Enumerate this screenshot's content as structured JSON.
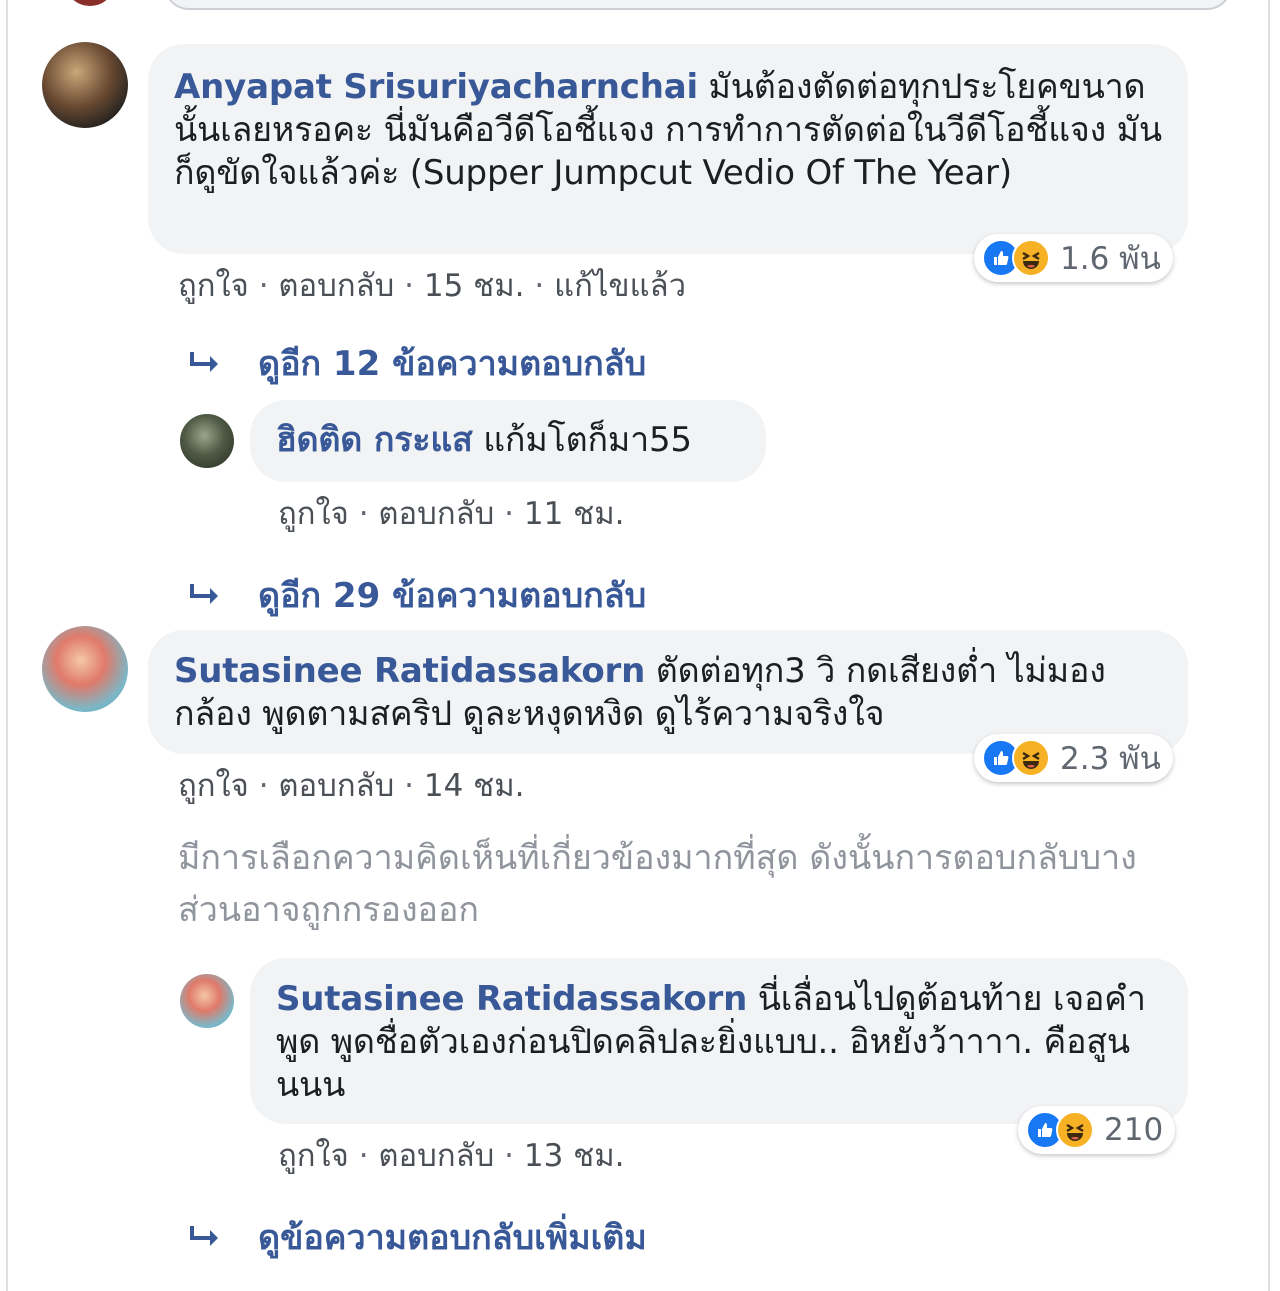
{
  "comments": [
    {
      "name": "Anyapat Srisuriyacharnchai",
      "text": "มันต้องตัดต่อทุกประโยคขนาดนั้นเลยหรอคะ นี่มันคือวีดีโอชี้แจง การทำการตัดต่อในวีดีโอชี้แจง มันก็ดูขัดใจแล้วค่ะ (Supper Jumpcut Vedio Of The Year)",
      "reaction_count": "1.6 พัน",
      "like": "ถูกใจ",
      "reply": "ตอบกลับ",
      "time": "15 ชม.",
      "edited": "แก้ไขแล้ว"
    },
    {
      "name": "Sutasinee Ratidassakorn",
      "text": "ตัดต่อทุก3 วิ กดเสียงต่ำ ไม่มองกล้อง พูดตามสคริป ดูละหงุดหงิด ดูไร้ความจริงใจ",
      "reaction_count": "2.3 พัน",
      "like": "ถูกใจ",
      "reply": "ตอบกลับ",
      "time": "14 ชม."
    }
  ],
  "replies": [
    {
      "name": "ฮิดติด กระแส",
      "text": "แก้มโตก็มา55",
      "like": "ถูกใจ",
      "reply": "ตอบกลับ",
      "time": "11 ชม."
    },
    {
      "name": "Sutasinee Ratidassakorn",
      "text": "นี่เลื่อนไปดูต้อนท้าย เจอคำพูด พูดชื่อตัวเองก่อนปิดคลิปละยิ่งแบบ.. อิหยังว้าาาา. คือสูนนนน",
      "reaction_count": "210",
      "like": "ถูกใจ",
      "reply": "ตอบกลับ",
      "time": "13 ชม."
    }
  ],
  "more_replies": {
    "first": "ดูอีก 12 ข้อความตอบกลับ",
    "second": "ดูอีก 29 ข้อความตอบกลับ",
    "third": "ดูข้อความตอบกลับเพิ่มเติม"
  },
  "filter_note": "มีการเลือกความคิดเห็นที่เกี่ยวข้องมากที่สุด ดังนั้นการตอบกลับบางส่วนอาจถูกกรองออก",
  "separator": "·",
  "colors": {
    "name": "#385898",
    "bubble": "#f2f3f5",
    "meta": "#606770",
    "like_blue": "#1877f2",
    "haha_yellow": "#f7b125"
  },
  "icons": [
    "like-icon",
    "haha-icon",
    "reply-arrow-icon"
  ]
}
